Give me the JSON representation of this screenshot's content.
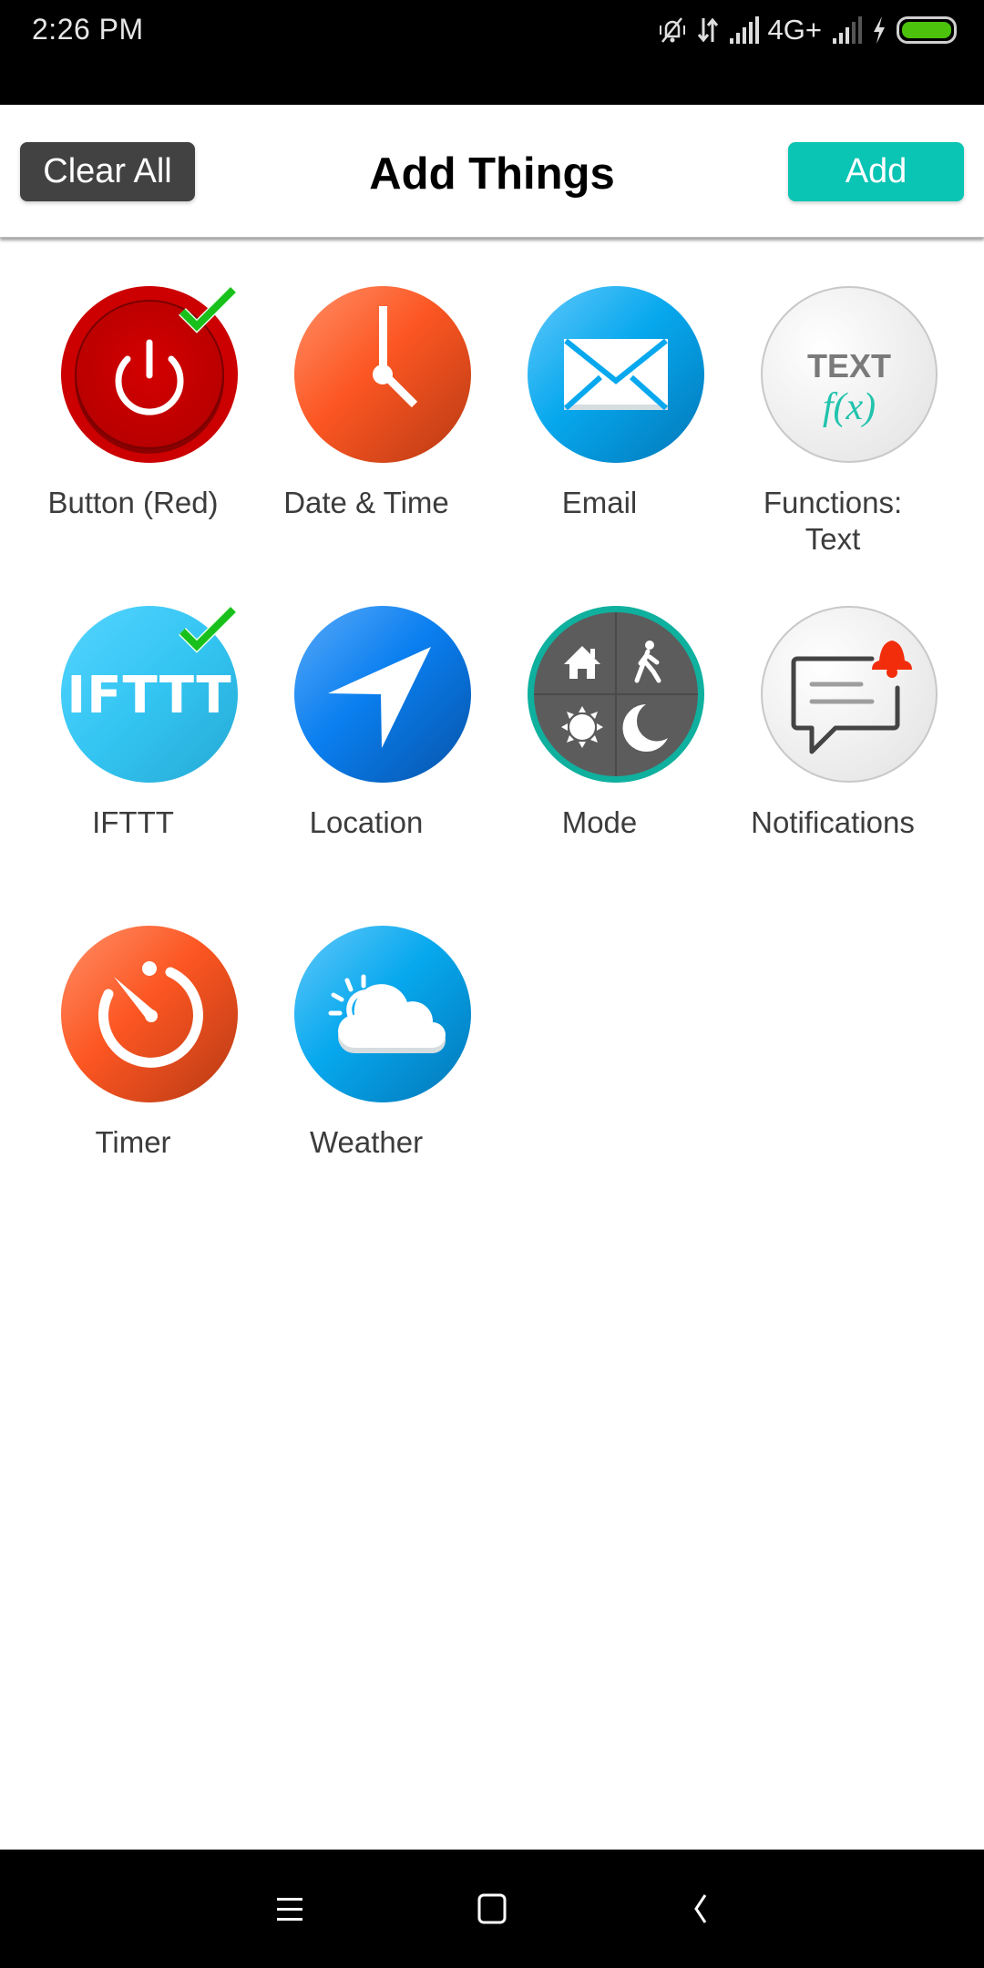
{
  "status_bar": {
    "time": "2:26 PM",
    "network_label": "4G+",
    "icons": [
      "vibrate-off-icon",
      "data-transfer-icon",
      "signal-icon",
      "signal-weak-icon",
      "charging-icon",
      "battery-icon"
    ],
    "battery_color": "#4cc20c"
  },
  "header": {
    "title": "Add Things",
    "clear_all_label": "Clear All",
    "add_label": "Add",
    "add_color": "#0ac4b4",
    "clear_color": "#424242"
  },
  "things": [
    {
      "label": "Button (Red)",
      "icon": "power-button-icon",
      "selected": true
    },
    {
      "label": "Date & Time",
      "icon": "clock-icon",
      "selected": false
    },
    {
      "label": "Email",
      "icon": "envelope-icon",
      "selected": false
    },
    {
      "label": "Functions: Text",
      "icon": "text-function-icon",
      "icon_text": "TEXT",
      "icon_formula": "f(x)",
      "selected": false
    },
    {
      "label": "IFTTT",
      "icon": "ifttt-icon",
      "icon_text": "IFTTT",
      "selected": true
    },
    {
      "label": "Location",
      "icon": "navigation-arrow-icon",
      "selected": false
    },
    {
      "label": "Mode",
      "icon": "mode-icon",
      "selected": false
    },
    {
      "label": "Notifications",
      "icon": "notification-bell-icon",
      "selected": false
    },
    {
      "label": "Timer",
      "icon": "timer-icon",
      "selected": false
    },
    {
      "label": "Weather",
      "icon": "weather-icon",
      "selected": false
    }
  ],
  "nav_bar": {
    "buttons": [
      "menu-icon",
      "home-icon",
      "back-icon"
    ]
  }
}
